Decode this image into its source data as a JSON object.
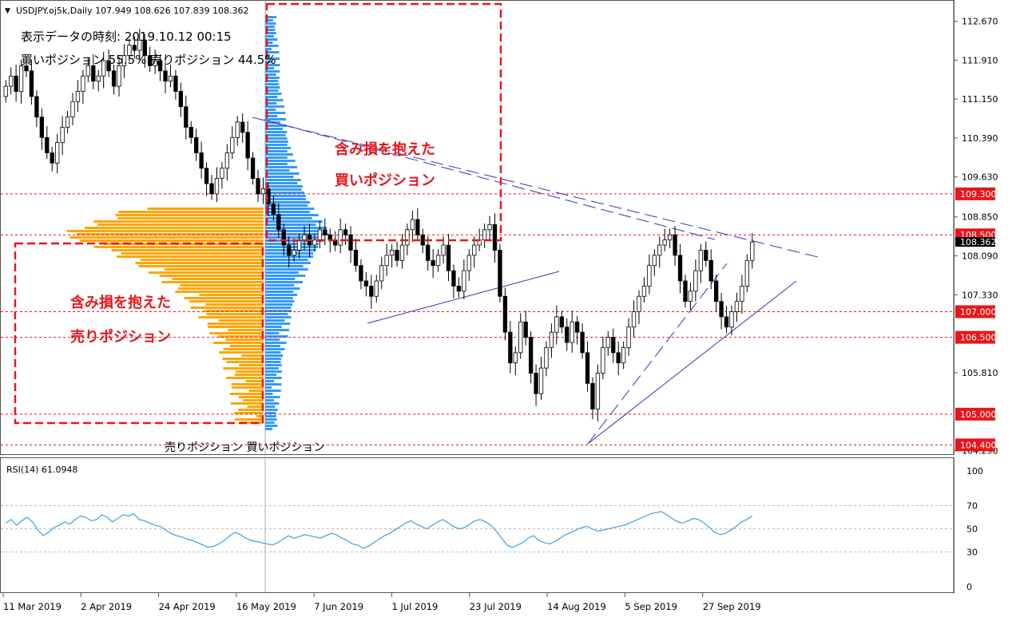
{
  "header": {
    "symbol_line": "USDJPY.oj5k,Daily  107.949 108.626 107.839 108.362",
    "info_time": "表示データの時刻: 2019.10.12 00:15",
    "info_ratio": "買いポジション 55.5% 売りポジション 44.5%"
  },
  "annotations": {
    "buy_line1": "含み損を抱えた",
    "buy_line2": "買いポジション",
    "sell_line1": "含み損を抱えた",
    "sell_line2": "売りポジション",
    "bottom_label": "売りポジション  買いポジション"
  },
  "rsi_label": "RSI(14) 61.0948",
  "colors": {
    "candle": "#000000",
    "buy_profile": "#3399ff",
    "sell_profile": "#ffa500",
    "annotation_red": "#e8161b",
    "level_tag_bg": "#e8161b",
    "trendline": "#3333bb",
    "rsi_line": "#3d9fe0",
    "price_tag_bg": "#000000"
  },
  "chart_data": [
    {
      "type": "candlestick",
      "symbol": "USDJPY.oj5k",
      "timeframe": "Daily",
      "ohlc_latest": {
        "open": 107.949,
        "high": 108.626,
        "low": 107.839,
        "close": 108.362
      },
      "y_ticks": [
        "112.670",
        "111.910",
        "111.150",
        "110.390",
        "109.630",
        "108.850",
        "108.090",
        "107.330",
        "105.810",
        "104.290"
      ],
      "ylim": [
        104.25,
        112.85
      ],
      "x_ticks": [
        "11 Mar 2019",
        "2 Apr 2019",
        "24 Apr 2019",
        "16 May 2019",
        "7 Jun 2019",
        "1 Jul 2019",
        "23 Jul 2019",
        "14 Aug 2019",
        "5 Sep 2019",
        "27 Sep 2019"
      ],
      "level_tags": [
        "109.300",
        "108.500",
        "107.000",
        "106.500",
        "105.000",
        "104.400"
      ],
      "current_price_tag": "108.362",
      "closes": [
        111.4,
        111.6,
        111.3,
        111.8,
        111.7,
        111.2,
        110.8,
        110.4,
        110.1,
        109.9,
        110.3,
        110.6,
        110.8,
        111.1,
        111.3,
        111.6,
        111.8,
        111.5,
        111.6,
        111.9,
        111.7,
        111.4,
        111.8,
        112.0,
        112.2,
        112.1,
        112.3,
        112.0,
        111.8,
        111.9,
        111.7,
        111.5,
        111.6,
        111.3,
        111.0,
        110.6,
        110.4,
        110.1,
        109.8,
        109.5,
        109.3,
        109.6,
        109.8,
        110.1,
        110.4,
        110.7,
        110.5,
        110.0,
        109.6,
        109.3,
        109.4,
        109.1,
        108.9,
        108.6,
        108.3,
        108.1,
        108.2,
        108.4,
        108.5,
        108.3,
        108.4,
        108.6,
        108.5,
        108.4,
        108.3,
        108.6,
        108.5,
        108.2,
        107.9,
        107.6,
        107.5,
        107.3,
        107.6,
        107.9,
        108.1,
        108.2,
        108.0,
        108.3,
        108.6,
        108.8,
        108.5,
        108.3,
        108.0,
        107.9,
        108.1,
        108.3,
        107.8,
        107.5,
        107.4,
        107.8,
        108.1,
        108.3,
        108.4,
        108.6,
        108.7,
        108.2,
        107.3,
        106.6,
        106.0,
        106.2,
        106.8,
        106.5,
        105.8,
        105.4,
        105.9,
        106.3,
        106.6,
        106.9,
        106.7,
        106.4,
        106.8,
        106.6,
        106.2,
        105.6,
        105.1,
        105.8,
        106.3,
        106.5,
        106.2,
        106.0,
        106.3,
        106.7,
        107.0,
        107.3,
        107.5,
        107.9,
        108.1,
        108.3,
        108.4,
        108.5,
        108.1,
        107.6,
        107.2,
        107.4,
        107.8,
        108.2,
        108.0,
        107.6,
        107.2,
        106.9,
        106.7,
        107.0,
        107.2,
        107.5,
        108.0,
        108.362
      ]
    },
    {
      "type": "line",
      "name": "RSI(14)",
      "last_value": 61.0948,
      "y_ticks": [
        "100",
        "70",
        "50",
        "30",
        "0"
      ],
      "ylim": [
        0,
        100
      ],
      "values": [
        55,
        58,
        53,
        57,
        60,
        56,
        49,
        44,
        47,
        51,
        53,
        56,
        54,
        58,
        61,
        60,
        57,
        58,
        62,
        60,
        56,
        59,
        62,
        61,
        63,
        58,
        57,
        55,
        53,
        52,
        49,
        46,
        44,
        43,
        41,
        40,
        38,
        36,
        34,
        35,
        37,
        40,
        44,
        47,
        45,
        42,
        40,
        39,
        38,
        37,
        36,
        38,
        41,
        44,
        42,
        43,
        45,
        44,
        43,
        42,
        44,
        46,
        45,
        42,
        40,
        37,
        36,
        33,
        35,
        38,
        41,
        44,
        46,
        49,
        52,
        55,
        57,
        54,
        52,
        50,
        53,
        56,
        58,
        55,
        52,
        50,
        51,
        54,
        57,
        58,
        56,
        53,
        48,
        42,
        36,
        34,
        36,
        38,
        42,
        44,
        40,
        38,
        37,
        39,
        42,
        45,
        47,
        49,
        51,
        52,
        50,
        48,
        49,
        50,
        51,
        52,
        53,
        55,
        57,
        59,
        61,
        63,
        64,
        65,
        62,
        59,
        56,
        55,
        57,
        59,
        58,
        55,
        51,
        47,
        45,
        46,
        49,
        52,
        56,
        58,
        61.0948
      ]
    }
  ]
}
